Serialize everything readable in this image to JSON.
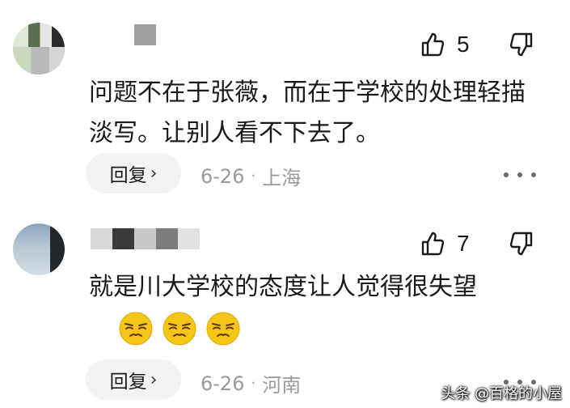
{
  "comments": [
    {
      "likes": "5",
      "text": "问题不在于张薇，而在于学校的处理轻描淡写。让别人看不下去了。",
      "reply_label": "回复",
      "date": "6-26",
      "location": "上海"
    },
    {
      "likes": "7",
      "text": "就是川大学校的态度让人觉得很失望",
      "reply_label": "回复",
      "date": "6-26",
      "location": "河南"
    }
  ],
  "icons": {
    "like": "thumbs-up-outline",
    "dislike": "thumbs-down-outline",
    "more": "more-dots",
    "emoji": "smirk-face"
  },
  "watermark": "头条 @百格的小屋",
  "colors": {
    "text": "#1a1a1a",
    "meta": "#9a9a9a",
    "reply_bg": "#f3f3f3",
    "emoji": "#f5c518"
  }
}
